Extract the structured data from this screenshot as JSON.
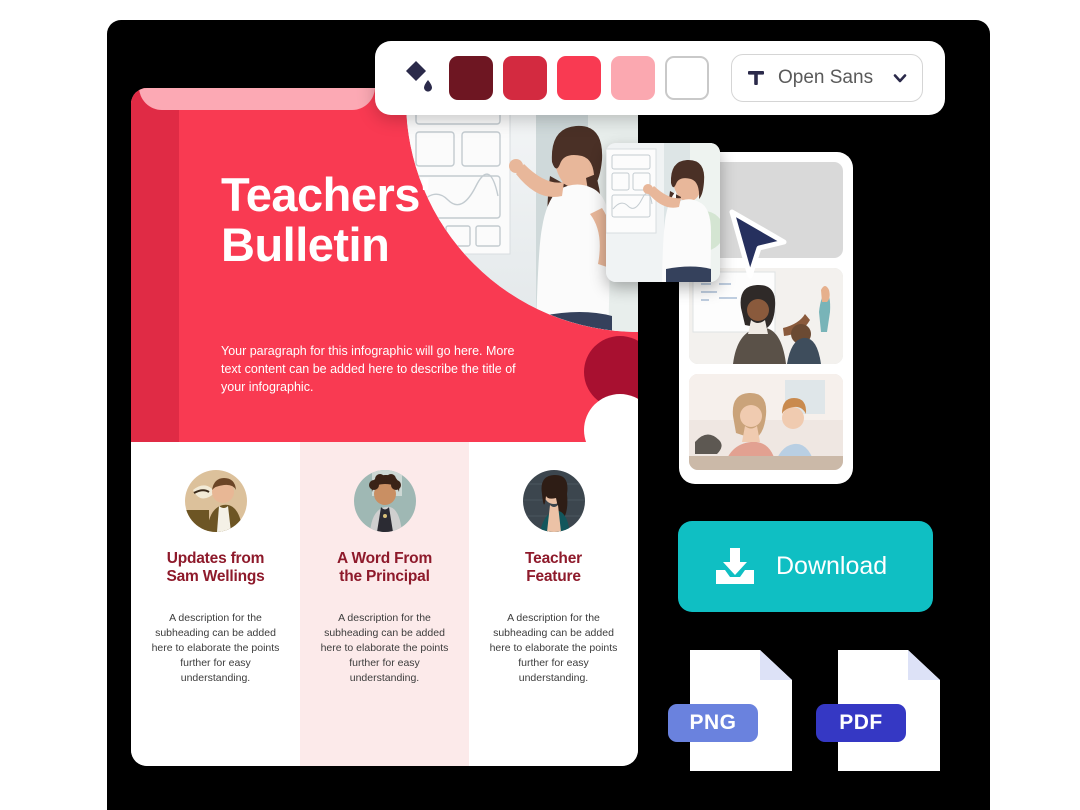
{
  "toolbar": {
    "fill_icon": "paint-bucket-icon",
    "swatches": [
      {
        "name": "swatch-dark-maroon",
        "color": "#6E1622"
      },
      {
        "name": "swatch-crimson",
        "color": "#D32A40"
      },
      {
        "name": "swatch-red",
        "color": "#F93A52"
      },
      {
        "name": "swatch-pink",
        "color": "#FBA8B0"
      },
      {
        "name": "swatch-white",
        "color": "#FFFFFF"
      }
    ],
    "font_select": {
      "icon": "text-format-icon",
      "value": "Open Sans",
      "chevron": "chevron-down-icon"
    }
  },
  "poster": {
    "title": "Teachers'\nBulletin",
    "paragraph": "Your paragraph for this infographic will go here. More text content can be added here to describe the title of your infographic.",
    "accent_color": "#F93A52",
    "strip_color": "#E02B45",
    "tab_color": "#FCA9B4",
    "circle_dark_color": "#A81030",
    "columns": [
      {
        "avatar": "avatar-sam-wellings",
        "title": "Updates from\nSam Wellings",
        "description": "A description for the subheading can be added here to elaborate the points further for easy understanding."
      },
      {
        "avatar": "avatar-principal",
        "title": "A Word From\nthe Principal",
        "description": "A description for the subheading can be added here to elaborate the points further for easy understanding."
      },
      {
        "avatar": "avatar-teacher-feature",
        "title": "Teacher\nFeature",
        "description": "A description for the subheading can be added here to elaborate the points further for easy understanding."
      }
    ],
    "heading_color": "#8E1A2B",
    "tinted_column_color": "#FCEAEA"
  },
  "media_panel": {
    "thumbnails": [
      {
        "name": "thumbnail-placeholder-gray"
      },
      {
        "name": "thumbnail-classroom-raised-hand"
      },
      {
        "name": "thumbnail-teacher-student-desk"
      }
    ],
    "drag_card": "drag-preview-teacher-whiteboard",
    "cursor": "cursor-arrow-icon"
  },
  "download": {
    "icon": "download-tray-icon",
    "label": "Download",
    "color": "#0FBFC3"
  },
  "export_files": [
    {
      "name": "file-png",
      "label": "PNG",
      "badge_color": "#6A82DE"
    },
    {
      "name": "file-pdf",
      "label": "PDF",
      "badge_color": "#3538C4"
    }
  ]
}
